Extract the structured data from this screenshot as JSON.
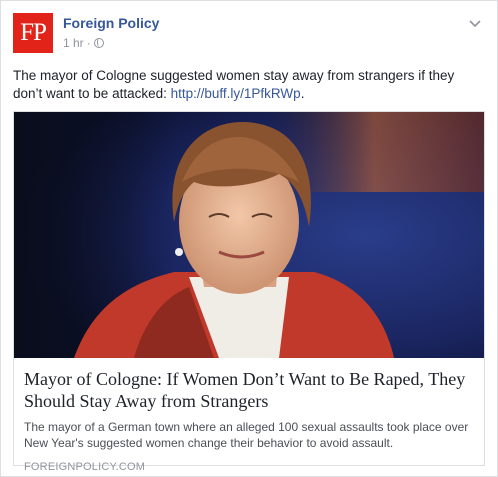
{
  "post": {
    "page_name": "Foreign Policy",
    "logo_text": "FP",
    "timestamp": "1 hr",
    "separator": "·",
    "privacy_icon": "globe-icon",
    "menu_icon": "chevron-down-icon",
    "status_text": "The mayor of Cologne suggested women stay away from strangers if they don’t want to be attacked: ",
    "status_link": "http://buff.ly/1PfkRWp",
    "status_end": "."
  },
  "link_card": {
    "image_alt": "Photo of the mayor of Cologne",
    "title": "Mayor of Cologne: If Women Don’t Want to Be Raped, They Should Stay Away from Strangers",
    "description": "The mayor of a German town where an alleged 100 sexual assaults took place over New Year's suggested women change their behavior to avoid assault.",
    "domain": "FOREIGNPOLICY.COM"
  },
  "colors": {
    "brand_red": "#e2231a",
    "link_blue": "#365899",
    "meta_gray": "#90949c"
  }
}
